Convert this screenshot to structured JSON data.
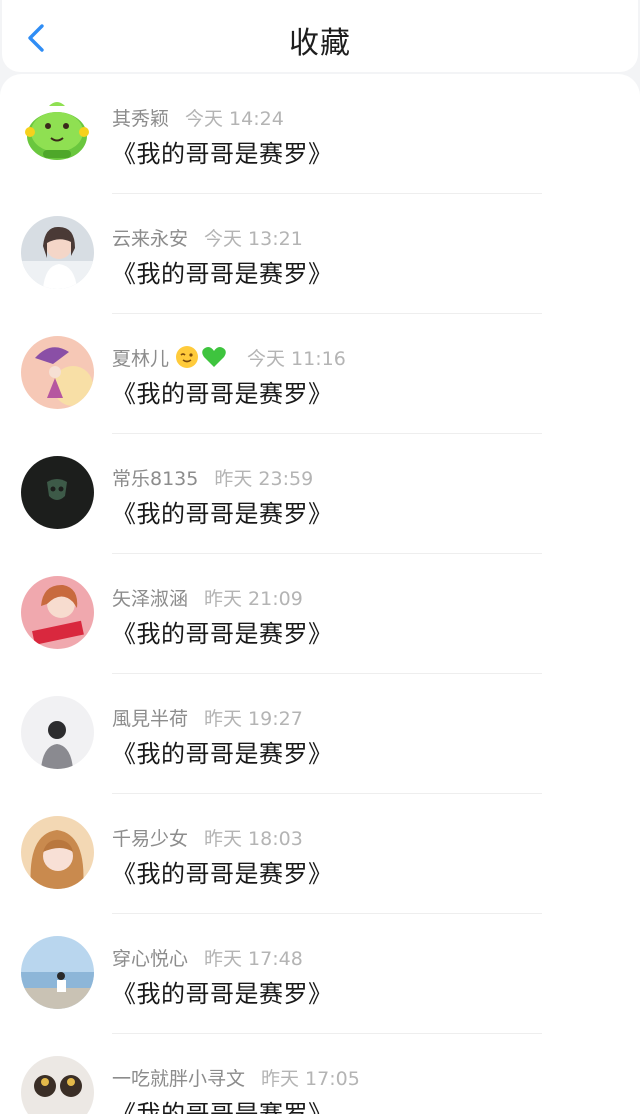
{
  "header": {
    "title": "收藏"
  },
  "items": [
    {
      "name": "其秀颖",
      "time": "今天 14:24",
      "text": "《我的哥哥是赛罗》",
      "avatar": "green-monster-avatar"
    },
    {
      "name": "云来永安",
      "time": "今天 13:21",
      "text": "《我的哥哥是赛罗》",
      "avatar": "girl-portrait-avatar"
    },
    {
      "name": "夏林儿",
      "emoji": [
        "wink-emoji",
        "green-heart-emoji"
      ],
      "time": "今天 11:16",
      "text": "《我的哥哥是赛罗》",
      "avatar": "umbrella-girl-avatar"
    },
    {
      "name": "常乐8135",
      "time": "昨天 23:59",
      "text": "《我的哥哥是赛罗》",
      "avatar": "dark-emblem-avatar"
    },
    {
      "name": "矢泽淑涵",
      "time": "昨天 21:09",
      "text": "《我的哥哥是赛罗》",
      "avatar": "pink-girl-avatar"
    },
    {
      "name": "風見半荷",
      "time": "昨天 19:27",
      "text": "《我的哥哥是赛罗》",
      "avatar": "boy-profile-avatar"
    },
    {
      "name": "千易少女",
      "time": "昨天 18:03",
      "text": "《我的哥哥是赛罗》",
      "avatar": "blonde-girl-avatar"
    },
    {
      "name": "穿心悦心",
      "time": "昨天 17:48",
      "text": "《我的哥哥是赛罗》",
      "avatar": "seaside-avatar"
    },
    {
      "name": "一吃就胖小寻文",
      "time": "昨天 17:05",
      "text": "《我的哥哥是赛罗》",
      "avatar": "figurines-avatar"
    }
  ],
  "colors": {
    "accent": "#2f8df5",
    "name": "#8c8c8c",
    "time": "#b4b4b4",
    "text": "#1a1a1a"
  }
}
